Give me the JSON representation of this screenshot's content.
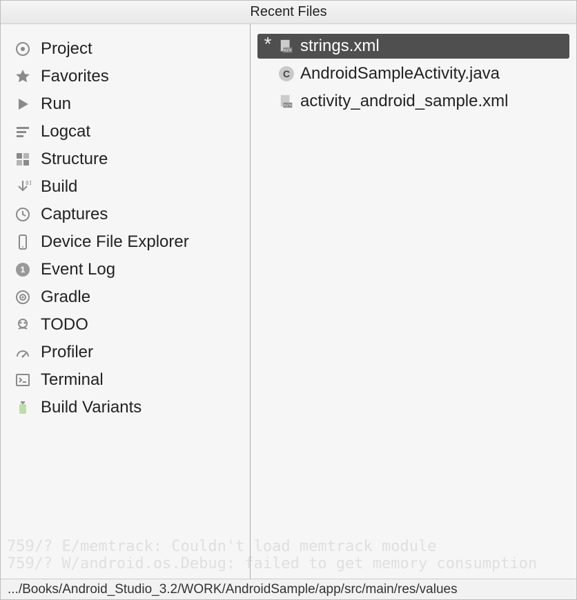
{
  "title": "Recent Files",
  "tools": [
    {
      "icon": "project",
      "label": "Project"
    },
    {
      "icon": "star",
      "label": "Favorites"
    },
    {
      "icon": "run",
      "label": "Run"
    },
    {
      "icon": "logcat",
      "label": "Logcat"
    },
    {
      "icon": "structure",
      "label": "Structure"
    },
    {
      "icon": "build",
      "label": "Build"
    },
    {
      "icon": "captures",
      "label": "Captures"
    },
    {
      "icon": "device",
      "label": "Device File Explorer"
    },
    {
      "icon": "eventlog",
      "label": "Event Log"
    },
    {
      "icon": "gradle",
      "label": "Gradle"
    },
    {
      "icon": "todo",
      "label": "TODO"
    },
    {
      "icon": "profiler",
      "label": "Profiler"
    },
    {
      "icon": "terminal",
      "label": "Terminal"
    },
    {
      "icon": "variants",
      "label": "Build Variants"
    }
  ],
  "files": [
    {
      "icon": "xml",
      "name": "strings.xml",
      "modified": true,
      "selected": true
    },
    {
      "icon": "java",
      "name": "AndroidSampleActivity.java",
      "modified": false,
      "selected": false
    },
    {
      "icon": "xml",
      "name": "activity_android_sample.xml",
      "modified": false,
      "selected": false
    }
  ],
  "statusbar": ".../Books/Android_Studio_3.2/WORK/AndroidSample/app/src/main/res/values"
}
